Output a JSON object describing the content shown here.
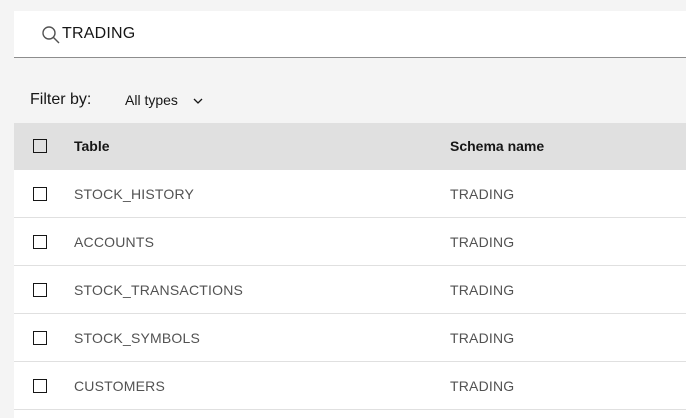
{
  "search": {
    "value": "TRADING",
    "icon": "search-icon"
  },
  "filter": {
    "label": "Filter by:",
    "selected": "All types",
    "icon": "chevron-down-icon"
  },
  "table": {
    "columns": [
      "Table",
      "Schema name"
    ],
    "rows": [
      {
        "table": "STOCK_HISTORY",
        "schema": "TRADING"
      },
      {
        "table": "ACCOUNTS",
        "schema": "TRADING"
      },
      {
        "table": "STOCK_TRANSACTIONS",
        "schema": "TRADING"
      },
      {
        "table": "STOCK_SYMBOLS",
        "schema": "TRADING"
      },
      {
        "table": "CUSTOMERS",
        "schema": "TRADING"
      }
    ]
  },
  "colors": {
    "background": "#f4f4f4",
    "header": "#e0e0e0",
    "text": "#161616",
    "muted": "#525252"
  }
}
